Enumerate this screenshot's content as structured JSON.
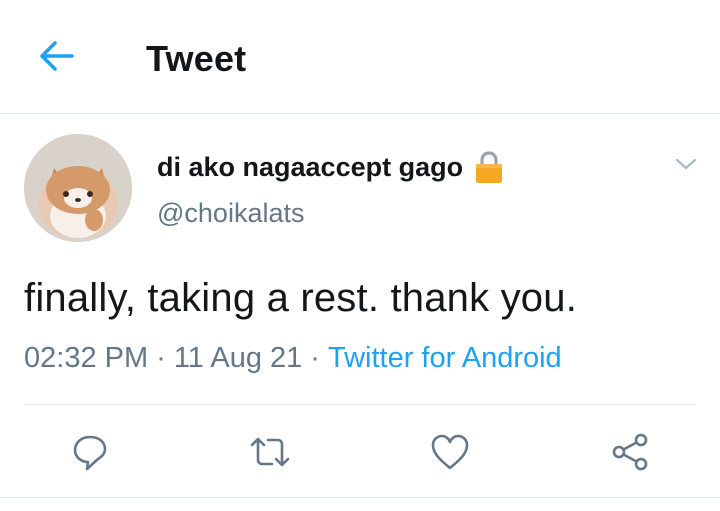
{
  "header": {
    "title": "Tweet",
    "back_icon": "arrow-left-icon"
  },
  "tweet": {
    "display_name": "di ako nagaaccept gago",
    "protected_icon": "lock-icon",
    "handle": "@choikalats",
    "text": "finally, taking a rest. thank you.",
    "time": "02:32 PM",
    "date": "11 Aug 21",
    "separator": "·",
    "source": "Twitter for Android"
  },
  "actions": [
    "reply-icon",
    "retweet-icon",
    "like-icon",
    "share-icon"
  ],
  "colors": {
    "accent": "#1da1f2",
    "secondary_text": "#657786",
    "lock": "#f5a623"
  }
}
